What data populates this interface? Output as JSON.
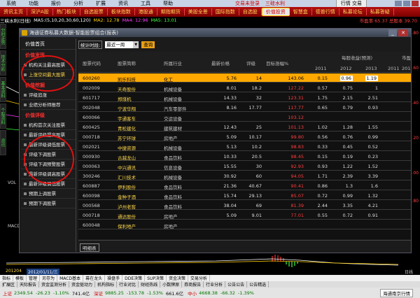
{
  "menubar": {
    "items": [
      "系统",
      "功能",
      "报价",
      "分析",
      "扩展",
      "资讯",
      "工具",
      "帮助"
    ],
    "brand": "交易未登录",
    "brand2": "三硅水利",
    "login": "行情 交易"
  },
  "toolbar": {
    "items": [
      "资讯主页",
      "深沪A股",
      "热门板块",
      "自选股票",
      "板块指数",
      "港股通",
      "期指期货",
      "美股全景",
      "国际指数",
      "自选股",
      "价值投资",
      "智慧盒",
      "德普行情",
      "私募论坛",
      "私募答疑"
    ],
    "active_index": 10
  },
  "chart_info": {
    "title": "三峡水利(日线)",
    "ma5": "MA5:(5,10,20,30,60,120)",
    "ma10": "MA2: 12.78",
    "ma20": "MA4: 12.96",
    "ma60": "MA5: 13.01",
    "right": "市盈率 65.37  总股本 39.70"
  },
  "leftstrip": [
    "分时走势",
    "技术分析",
    "基本资料",
    "个股资料",
    "资讯"
  ],
  "right_axis": [
    "16.80",
    "15.60",
    "14.40",
    "13.20",
    "12.00",
    "10.80",
    "VOL",
    "MACD"
  ],
  "window": {
    "title": "海通证券私募大数据-智能股票组合(报表)",
    "close": "✕",
    "min": "_"
  },
  "sidemenu": {
    "sections": [
      {
        "title": "价值首页",
        "items": []
      },
      {
        "title": "价值发现",
        "items": [
          "机构关注最高股票",
          "上涨空间最大股票"
        ]
      },
      {
        "title": "价值挖掘",
        "items": [
          "评级追涨",
          "业绩分析师推荐"
        ]
      },
      {
        "title": "价值评级",
        "items": [
          "机构首次关注股票",
          "最新评级提高股票",
          "最新评级调低股票",
          "评级下调股票",
          "评级下调预警股票",
          "最新评级调高股票",
          "最新评级调低股票",
          "预期上调股票",
          "预期下调股票"
        ]
      }
    ]
  },
  "filter": {
    "label": "统计时段:",
    "value": "最近一周",
    "go": "查询"
  },
  "table": {
    "headers": {
      "code": "股票代码",
      "name": "股票简称",
      "industry": "所属行业",
      "price": "最新价格",
      "rating": "评级",
      "upside": "目标涨幅%",
      "eps_group": "每股收益(预测)",
      "pe_group": "市盈率",
      "years": [
        "2011",
        "2012",
        "2013",
        "2011",
        "2012"
      ]
    },
    "rows": [
      {
        "code": "600260",
        "name": "凯乐科技",
        "industry": "化工",
        "price": "5.76",
        "rating": "14",
        "upside": "143.06",
        "e2011": "0.15",
        "e2012": "0.96",
        "e2013": "1.19",
        "p2011": "",
        "p2012": "",
        "selected": true
      },
      {
        "code": "002009",
        "name": "天奇股份",
        "industry": "机械设备",
        "price": "8.01",
        "rating": "18.2",
        "upside": "127.22",
        "e2011": "0.57",
        "e2012": "0.75",
        "e2013": "1",
        "p2011": "",
        "p2012": ""
      },
      {
        "code": "601717",
        "name": "郑煤机",
        "industry": "机械设备",
        "price": "14.33",
        "rating": "32",
        "upside": "123.31",
        "e2011": "1.75",
        "e2012": "2.15",
        "e2013": "2.51",
        "p2011": "",
        "p2012": ""
      },
      {
        "code": "002048",
        "name": "宁波华翔",
        "industry": "汽车零部件",
        "price": "8.16",
        "rating": "17.77",
        "upside": "117.77",
        "e2011": "0.65",
        "e2012": "0.79",
        "e2013": "0.93",
        "p2011": "",
        "p2012": ""
      },
      {
        "code": "600066",
        "name": "宇通客车",
        "industry": "交运设备",
        "price": "",
        "rating": "",
        "upside": "103.12",
        "e2011": "",
        "e2012": "",
        "e2013": "",
        "p2011": "",
        "p2012": ""
      },
      {
        "code": "600425",
        "name": "青松建化",
        "industry": "建筑建材",
        "price": "12.43",
        "rating": "25",
        "upside": "101.13",
        "e2011": "1.02",
        "e2012": "1.28",
        "e2013": "1.55",
        "p2011": "",
        "p2012": ""
      },
      {
        "code": "000718",
        "name": "苏宁环球",
        "industry": "房地产",
        "price": "5.09",
        "rating": "10.17",
        "upside": "99.80",
        "e2011": "0.56",
        "e2012": "0.76",
        "e2013": "0.99",
        "p2011": "",
        "p2012": ""
      },
      {
        "code": "002021",
        "name": "中捷资源",
        "industry": "机械设备",
        "price": "5.13",
        "rating": "10.2",
        "upside": "98.83",
        "e2011": "0.33",
        "e2012": "0.45",
        "e2013": "0.52",
        "p2011": "",
        "p2012": ""
      },
      {
        "code": "000930",
        "name": "古越龙山",
        "industry": "食品饮料",
        "price": "10.33",
        "rating": "20.5",
        "upside": "98.45",
        "e2011": "0.15",
        "e2012": "0.19",
        "e2013": "0.23",
        "p2011": "",
        "p2012": ""
      },
      {
        "code": "000063",
        "name": "中兴通讯",
        "industry": "信息设备",
        "price": "15.55",
        "rating": "30",
        "upside": "92.93",
        "e2011": "0.93",
        "e2012": "1.22",
        "e2013": "1.52",
        "p2011": "",
        "p2012": ""
      },
      {
        "code": "300246",
        "name": "汇川技术",
        "industry": "机械设备",
        "price": "30.92",
        "rating": "60",
        "upside": "94.05",
        "e2011": "1.71",
        "e2012": "2.39",
        "e2013": "3.39",
        "p2011": "",
        "p2012": ""
      },
      {
        "code": "600887",
        "name": "伊利股份",
        "industry": "食品饮料",
        "price": "21.36",
        "rating": "40.67",
        "upside": "90.41",
        "e2011": "0.86",
        "e2012": "1.3",
        "e2013": "1.6",
        "p2011": "",
        "p2012": ""
      },
      {
        "code": "600098",
        "name": "金种子酒",
        "industry": "食品饮料",
        "price": "15.74",
        "rating": "29.13",
        "upside": "85.07",
        "e2011": "0.72",
        "e2012": "0.99",
        "e2013": "1.32",
        "p2011": "",
        "p2012": ""
      },
      {
        "code": "000568",
        "name": "泸州老窖",
        "industry": "食品饮料",
        "price": "38.04",
        "rating": "69",
        "upside": "81.39",
        "e2011": "2.44",
        "e2012": "3.35",
        "e2013": "4.21",
        "p2011": "",
        "p2012": ""
      },
      {
        "code": "000718",
        "name": "通达股份",
        "industry": "房地产",
        "price": "5.09",
        "rating": "9.01",
        "upside": "77.01",
        "e2011": "0.55",
        "e2012": "0.72",
        "e2013": "0.91",
        "p2011": "",
        "p2012": ""
      },
      {
        "code": "600048",
        "name": "保利地产",
        "industry": "房地产",
        "price": "",
        "rating": "",
        "upside": "",
        "e2011": "",
        "e2012": "",
        "e2013": "",
        "p2011": "",
        "p2012": ""
      }
    ]
  },
  "footer": {
    "btn": "明细表"
  },
  "datebar": {
    "date": "201204",
    "date2": "2012/01/11/三",
    "right": "日线"
  },
  "tabs1": [
    "指标",
    "模板",
    "管理",
    "另存为",
    "MACD基本",
    "幕在龙头",
    "操盘手",
    "DDE决策",
    "SUP决策",
    "资金决策",
    "交易分析"
  ],
  "tabs2": [
    "扩展区",
    "天际报告",
    "资金监测分析",
    "资金驱动力",
    "机构指标",
    "行业对比",
    "财经热线",
    "小数牌原",
    "券商报告",
    "行业分析",
    "公告公告",
    "公告精选"
  ],
  "status": {
    "sh_label": "上证",
    "sh_val": "2349.54",
    "sh_chg": "-26.23",
    "sh_pct": "-1.10%",
    "sh_vol": "741.4亿",
    "sz_label": "深证",
    "sz_val": "9885.25",
    "sz_chg": "-153.78",
    "sz_pct": "-1.53%",
    "sz_vol": "661.6亿",
    "zx_label": "中小",
    "zx_val": "4668.38",
    "zx_chg": "-66.32",
    "zx_pct": "-1.39%",
    "right": "海通南京行情"
  }
}
